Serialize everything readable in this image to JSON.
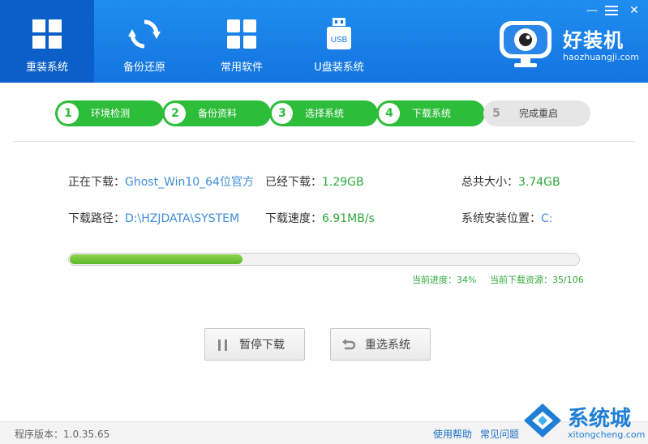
{
  "colors": {
    "header_blue": "#1474e0",
    "active_tab": "#0b5fc9",
    "step_green": "#2ebd3a",
    "value_blue": "#3c8ed8",
    "value_green": "#2eaa3a"
  },
  "nav": [
    {
      "label": "重装系统",
      "icon": "windows-logo-icon",
      "active": true
    },
    {
      "label": "备份还原",
      "icon": "sync-icon",
      "active": false
    },
    {
      "label": "常用软件",
      "icon": "apps-grid-icon",
      "active": false
    },
    {
      "label": "U盘装系统",
      "icon": "usb-drive-icon",
      "active": false
    }
  ],
  "window": {
    "minimize": "—",
    "close": "✕",
    "settings_icon": "menu-icon"
  },
  "brand": {
    "name": "好装机",
    "url": "haozhuangji.com"
  },
  "steps": [
    {
      "num": "1",
      "label": "环境检测",
      "done": true
    },
    {
      "num": "2",
      "label": "备份资料",
      "done": true
    },
    {
      "num": "3",
      "label": "选择系统",
      "done": true
    },
    {
      "num": "4",
      "label": "下载系统",
      "done": true
    },
    {
      "num": "5",
      "label": "完成重启",
      "done": false
    }
  ],
  "info": {
    "downloading_label": "正在下载：",
    "downloading_value": "Ghost_Win10_64位官方",
    "downloaded_label": "已经下载：",
    "downloaded_value": "1.29GB",
    "total_label": "总共大小：",
    "total_value": "3.74GB",
    "path_label": "下载路径：",
    "path_value": "D:\\HZJDATA\\SYSTEM",
    "speed_label": "下载速度：",
    "speed_value": "6.91MB/s",
    "install_label": "系统安装位置：",
    "install_value": "C:"
  },
  "progress": {
    "fraction": 0.34,
    "progress_label": "当前进度：",
    "progress_value": "34%",
    "resource_label": "当前下载资源：",
    "resource_value": "35/106"
  },
  "buttons": {
    "pause": "暂停下载",
    "reselect": "重选系统"
  },
  "footer": {
    "version": "程序版本：1.0.35.65",
    "help": "使用帮助",
    "faq": "常见问题"
  },
  "watermark": {
    "text": "系统城",
    "url": "xitongcheng.com"
  }
}
